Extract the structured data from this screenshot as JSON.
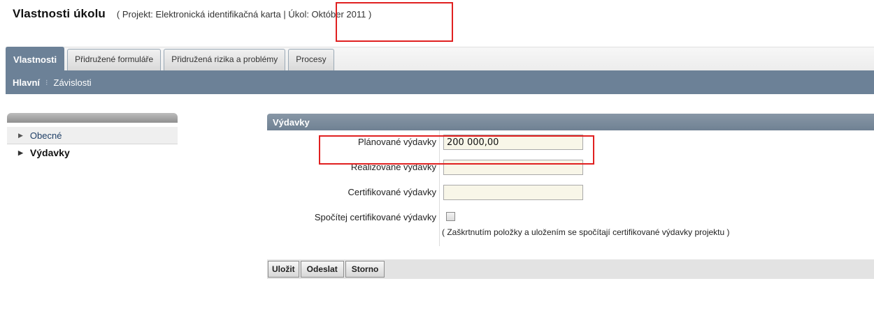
{
  "header": {
    "title": "Vlastnosti úkolu",
    "subtitle": "( Projekt: Elektronická identifikačná karta | Úkol: Október 2011 )"
  },
  "tabs": [
    {
      "label": "Vlastnosti",
      "active": true
    },
    {
      "label": "Přidružené formuláře",
      "active": false
    },
    {
      "label": "Přidružená rizika a problémy",
      "active": false
    },
    {
      "label": "Procesy",
      "active": false
    }
  ],
  "subnav": {
    "items": [
      "Hlavní",
      "Závislosti"
    ],
    "separator": "⁝"
  },
  "sidebar": {
    "items": [
      {
        "label": "Obecné",
        "active": false
      },
      {
        "label": "Výdavky",
        "active": true
      }
    ]
  },
  "panel": {
    "title": "Výdavky",
    "fields": [
      {
        "label": "Plánované výdavky",
        "value": "200 000,00"
      },
      {
        "label": "Realizované výdavky",
        "value": ""
      },
      {
        "label": "Certifikované výdavky",
        "value": ""
      }
    ],
    "checkbox": {
      "label": "Spočítej certifikované výdavky",
      "checked": false,
      "note": "( Zaškrtnutím položky a uložením se spočítají certifikované výdavky projektu )"
    }
  },
  "buttons": {
    "save": "Uložit",
    "send": "Odeslat",
    "cancel": "Storno"
  },
  "colors": {
    "accent": "#6c8197",
    "highlight": "#e02020",
    "input_bg": "#f8f6e8"
  }
}
